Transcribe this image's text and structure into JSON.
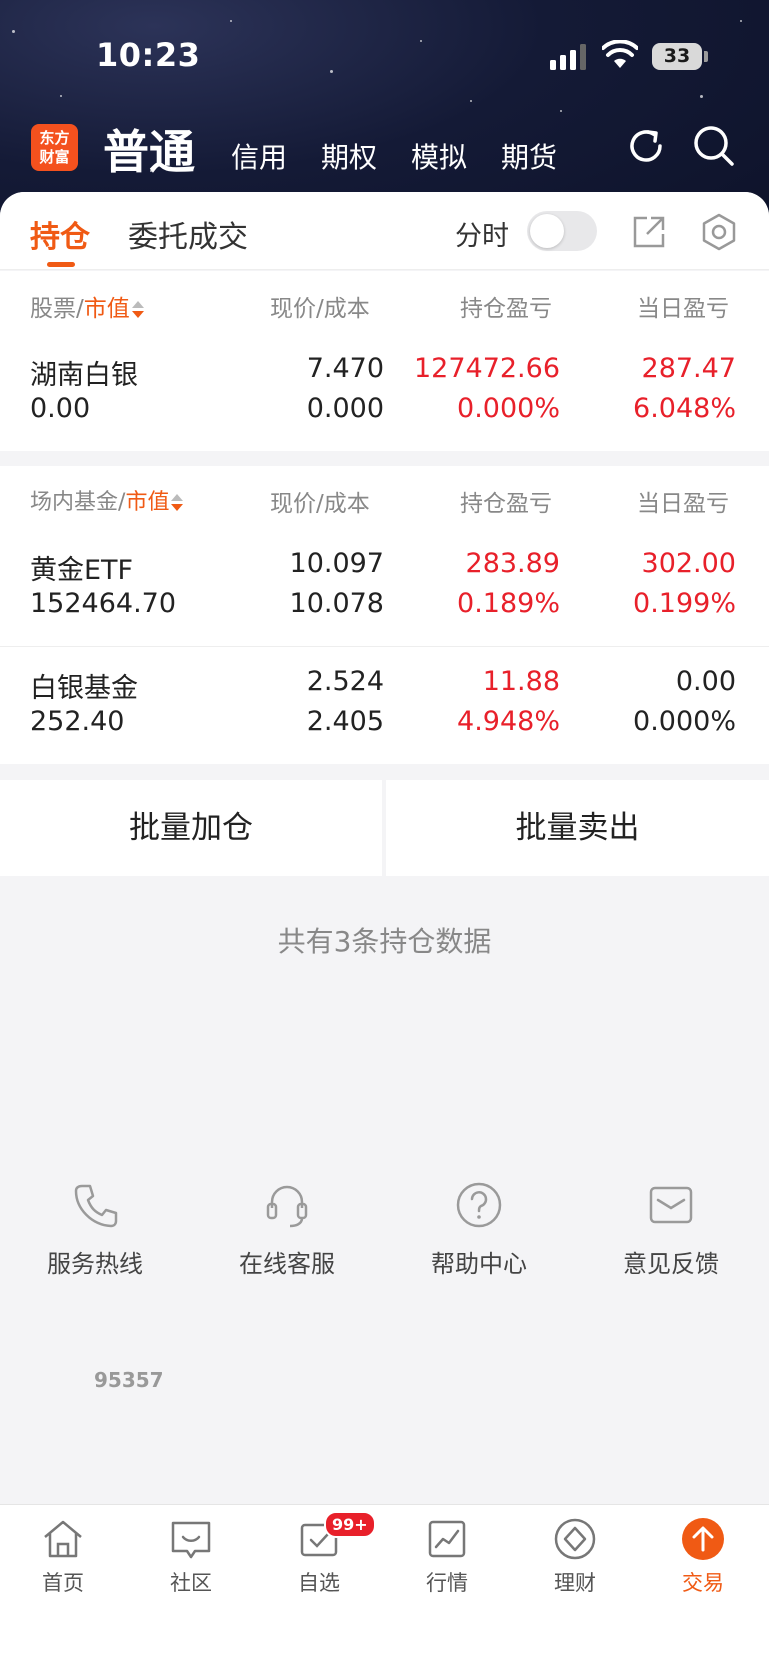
{
  "status_bar": {
    "time": "10:23",
    "battery": "33"
  },
  "top_nav": {
    "logo_line1": "东方",
    "logo_line2": "财富",
    "active": "普通",
    "tabs": [
      "信用",
      "期权",
      "模拟",
      "期货"
    ]
  },
  "sub_tabs": {
    "holdings": "持仓",
    "orders": "委托成交",
    "fenshi": "分时"
  },
  "stock_section": {
    "col1_a": "股票",
    "col1_b": "市值",
    "col2": "现价/成本",
    "col3": "持仓盈亏",
    "col4": "当日盈亏",
    "rows": [
      {
        "name": "湖南白银",
        "market_value": "0.00",
        "price": "7.470",
        "cost": "0.000",
        "pl": "127472.66",
        "pl_pct": "0.000%",
        "day_pl": "287.47",
        "day_pl_pct": "6.048%"
      }
    ]
  },
  "fund_section": {
    "col1_a": "场内基金",
    "col1_b": "市值",
    "col2": "现价/成本",
    "col3": "持仓盈亏",
    "col4": "当日盈亏",
    "rows": [
      {
        "name": "黄金ETF",
        "market_value": "152464.70",
        "price": "10.097",
        "cost": "10.078",
        "pl": "283.89",
        "pl_pct": "0.189%",
        "day_pl": "302.00",
        "day_pl_pct": "0.199%"
      },
      {
        "name": "白银基金",
        "market_value": "252.40",
        "price": "2.524",
        "cost": "2.405",
        "pl": "11.88",
        "pl_pct": "4.948%",
        "day_pl": "0.00",
        "day_pl_pct": "0.000%"
      }
    ]
  },
  "actions": {
    "add": "批量加仓",
    "sell": "批量卖出"
  },
  "footer_count": "共有3条持仓数据",
  "services": {
    "hotline_number": "95357",
    "items": [
      "服务热线",
      "在线客服",
      "帮助中心",
      "意见反馈"
    ]
  },
  "tabbar": {
    "items": [
      "首页",
      "社区",
      "自选",
      "行情",
      "理财",
      "交易"
    ],
    "badge": "99+"
  },
  "colors": {
    "accent": "#f05a14",
    "up": "#e8202a"
  }
}
